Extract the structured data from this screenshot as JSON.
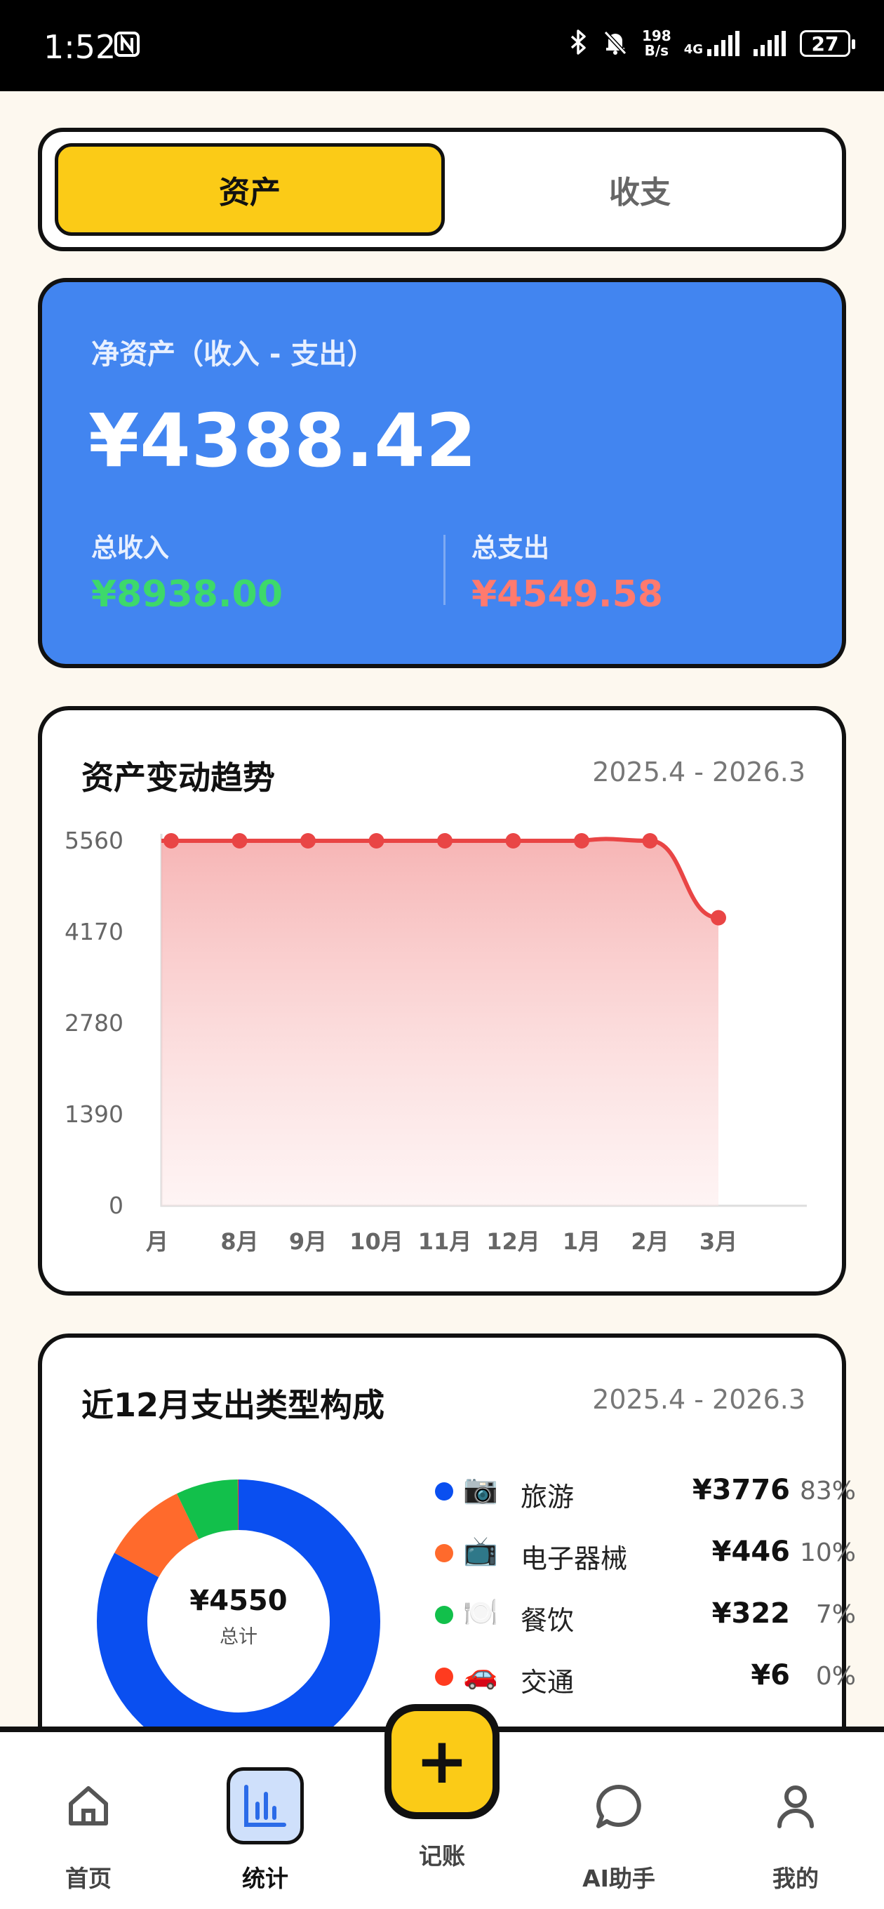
{
  "status_bar": {
    "time": "1:52",
    "net_speed_value": "198",
    "net_speed_unit": "B/s",
    "network_type": "4G",
    "battery": "27"
  },
  "segment": {
    "assets_label": "资产",
    "income_expense_label": "收支"
  },
  "net_assets": {
    "label": "净资产（收入 - 支出）",
    "value": "¥4388.42",
    "income_label": "总收入",
    "income_value": "¥8938.00",
    "expense_label": "总支出",
    "expense_value": "¥4549.58",
    "income_color": "#3dd96b",
    "expense_color": "#ff7a6e"
  },
  "trend_card": {
    "title": "资产变动趋势",
    "range": "2025.4 - 2026.3"
  },
  "chart_data": {
    "type": "area",
    "categories": [
      "月",
      "8月",
      "9月",
      "10月",
      "11月",
      "12月",
      "1月",
      "2月",
      "3月"
    ],
    "values": [
      5560,
      5560,
      5560,
      5560,
      5560,
      5560,
      5560,
      5560,
      4388
    ],
    "yticks": [
      5560,
      4170,
      2780,
      1390,
      0
    ],
    "ylim": [
      0,
      5560
    ],
    "color": "#e94545",
    "grid": false
  },
  "expense_card": {
    "title": "近12月支出类型构成",
    "range": "2025.4 - 2026.3",
    "total_value": "¥4550",
    "total_label": "总计",
    "items": [
      {
        "icon": "📷",
        "name": "旅游",
        "amount": "¥3776",
        "pct": "83%",
        "value": 3776,
        "color": "#0a4ff0"
      },
      {
        "icon": "📺",
        "name": "电子器械",
        "amount": "¥446",
        "pct": "10%",
        "value": 446,
        "color": "#ff6a2c"
      },
      {
        "icon": "🍽️",
        "name": "餐饮",
        "amount": "¥322",
        "pct": "7%",
        "value": 322,
        "color": "#12c04b"
      },
      {
        "icon": "🚗",
        "name": "交通",
        "amount": "¥6",
        "pct": "0%",
        "value": 6,
        "color": "#ff3b1f"
      }
    ]
  },
  "tabbar": {
    "home": "首页",
    "stats": "统计",
    "record": "记账",
    "ai": "AI助手",
    "me": "我的"
  }
}
